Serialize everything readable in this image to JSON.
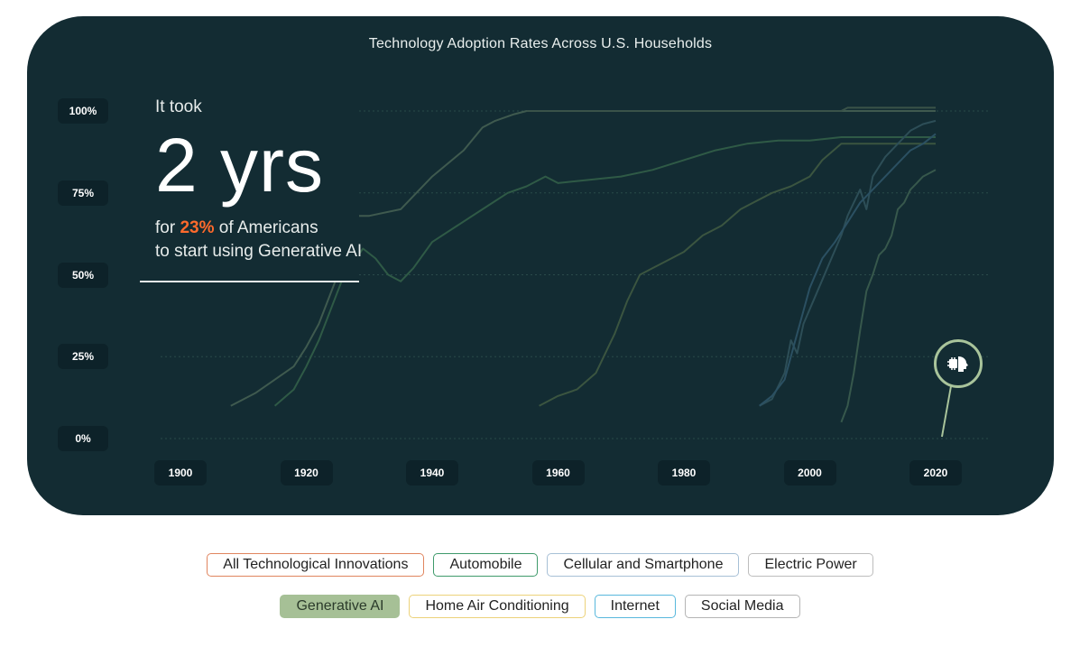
{
  "chart_data": {
    "type": "line",
    "title": "Technology Adoption Rates Across U.S. Households",
    "xlim": [
      1900,
      2020
    ],
    "ylim": [
      0,
      100
    ],
    "x_ticks": [
      "1900",
      "1920",
      "1940",
      "1960",
      "1980",
      "2000",
      "2020"
    ],
    "y_ticks": [
      "0%",
      "25%",
      "50%",
      "75%",
      "100%"
    ],
    "grid": "horizontal dotted",
    "series": [
      {
        "name": "Electric Power",
        "color": "#3f5a4f",
        "points": [
          [
            1908,
            10
          ],
          [
            1912,
            14
          ],
          [
            1915,
            18
          ],
          [
            1918,
            22
          ],
          [
            1920,
            28
          ],
          [
            1922,
            35
          ],
          [
            1924,
            45
          ],
          [
            1926,
            55
          ],
          [
            1928,
            68
          ],
          [
            1930,
            68
          ],
          [
            1935,
            70
          ],
          [
            1940,
            80
          ],
          [
            1945,
            88
          ],
          [
            1948,
            95
          ],
          [
            1950,
            97
          ],
          [
            1953,
            99
          ],
          [
            1955,
            100
          ],
          [
            2020,
            100
          ]
        ]
      },
      {
        "name": "Automobile",
        "color": "#2f5a46",
        "points": [
          [
            1915,
            10
          ],
          [
            1918,
            15
          ],
          [
            1920,
            22
          ],
          [
            1922,
            30
          ],
          [
            1924,
            40
          ],
          [
            1926,
            50
          ],
          [
            1929,
            58
          ],
          [
            1931,
            55
          ],
          [
            1933,
            50
          ],
          [
            1935,
            48
          ],
          [
            1937,
            52
          ],
          [
            1940,
            60
          ],
          [
            1944,
            65
          ],
          [
            1948,
            70
          ],
          [
            1952,
            75
          ],
          [
            1955,
            77
          ],
          [
            1958,
            80
          ],
          [
            1960,
            78
          ],
          [
            1965,
            79
          ],
          [
            1970,
            80
          ],
          [
            1975,
            82
          ],
          [
            1980,
            85
          ],
          [
            1985,
            88
          ],
          [
            1990,
            90
          ],
          [
            1995,
            91
          ],
          [
            2000,
            91
          ],
          [
            2005,
            92
          ],
          [
            2010,
            92
          ],
          [
            2020,
            92
          ]
        ]
      },
      {
        "name": "Home Air Conditioning",
        "color": "#3b5540",
        "points": [
          [
            1957,
            10
          ],
          [
            1960,
            13
          ],
          [
            1963,
            15
          ],
          [
            1966,
            20
          ],
          [
            1969,
            32
          ],
          [
            1971,
            42
          ],
          [
            1973,
            50
          ],
          [
            1975,
            52
          ],
          [
            1978,
            55
          ],
          [
            1980,
            57
          ],
          [
            1983,
            62
          ],
          [
            1986,
            65
          ],
          [
            1989,
            70
          ],
          [
            1991,
            72
          ],
          [
            1994,
            75
          ],
          [
            1997,
            77
          ],
          [
            2000,
            80
          ],
          [
            2002,
            85
          ],
          [
            2005,
            90
          ],
          [
            2010,
            90
          ],
          [
            2015,
            90
          ],
          [
            2020,
            90
          ]
        ]
      },
      {
        "name": "Cellular and Smartphone",
        "color": "#2d4e57",
        "points": [
          [
            1992,
            10
          ],
          [
            1994,
            12
          ],
          [
            1996,
            20
          ],
          [
            1997,
            30
          ],
          [
            1998,
            26
          ],
          [
            1999,
            35
          ],
          [
            2001,
            44
          ],
          [
            2003,
            53
          ],
          [
            2005,
            62
          ],
          [
            2006,
            68
          ],
          [
            2007,
            72
          ],
          [
            2008,
            76
          ],
          [
            2009,
            70
          ],
          [
            2010,
            80
          ],
          [
            2012,
            86
          ],
          [
            2014,
            90
          ],
          [
            2016,
            94
          ],
          [
            2018,
            96
          ],
          [
            2020,
            97
          ]
        ]
      },
      {
        "name": "Internet",
        "color": "#2b5062",
        "points": [
          [
            1992,
            10
          ],
          [
            1994,
            13
          ],
          [
            1996,
            18
          ],
          [
            1998,
            32
          ],
          [
            2000,
            46
          ],
          [
            2002,
            55
          ],
          [
            2004,
            60
          ],
          [
            2006,
            66
          ],
          [
            2008,
            72
          ],
          [
            2010,
            76
          ],
          [
            2012,
            80
          ],
          [
            2014,
            84
          ],
          [
            2016,
            88
          ],
          [
            2018,
            90
          ],
          [
            2020,
            93
          ]
        ]
      },
      {
        "name": "Social Media",
        "color": "#37584c",
        "points": [
          [
            2005,
            5
          ],
          [
            2006,
            10
          ],
          [
            2007,
            20
          ],
          [
            2008,
            33
          ],
          [
            2009,
            45
          ],
          [
            2010,
            50
          ],
          [
            2011,
            56
          ],
          [
            2012,
            58
          ],
          [
            2013,
            62
          ],
          [
            2014,
            70
          ],
          [
            2015,
            72
          ],
          [
            2016,
            76
          ],
          [
            2017,
            78
          ],
          [
            2018,
            80
          ],
          [
            2020,
            82
          ]
        ]
      },
      {
        "name": "All Technological Innovations",
        "color": "#3a5349",
        "points": [
          [
            1955,
            100
          ],
          [
            2005,
            100
          ],
          [
            2006,
            101
          ],
          [
            2020,
            101
          ]
        ]
      }
    ],
    "callout": {
      "pre": "It took",
      "big": "2 yrs",
      "line1_before": "for",
      "line1_accent": "23%",
      "line1_after": "of Americans",
      "line2": "to start using Generative AI"
    },
    "accent_color": "#ff6a2c",
    "marker": {
      "name": "Generative AI",
      "x": 2021,
      "y": 0,
      "icon": "chip-head-icon",
      "color": "#a9c49b"
    }
  },
  "legend": {
    "row1": [
      {
        "label": "All Technological Innovations",
        "border": "#e0855f",
        "active": false
      },
      {
        "label": "Automobile",
        "border": "#3f9a6b",
        "active": false
      },
      {
        "label": "Cellular and Smartphone",
        "border": "#a7c0d6",
        "active": false
      },
      {
        "label": "Electric Power",
        "border": "#bdbdbd",
        "active": false
      }
    ],
    "row2": [
      {
        "label": "Generative AI",
        "border": "#a6c096",
        "bg": "#a6c096",
        "active": true
      },
      {
        "label": "Home Air Conditioning",
        "border": "#ecd27a",
        "active": false
      },
      {
        "label": "Internet",
        "border": "#58b8dc",
        "active": false
      },
      {
        "label": "Social Media",
        "border": "#b4b4b4",
        "active": false
      }
    ]
  }
}
